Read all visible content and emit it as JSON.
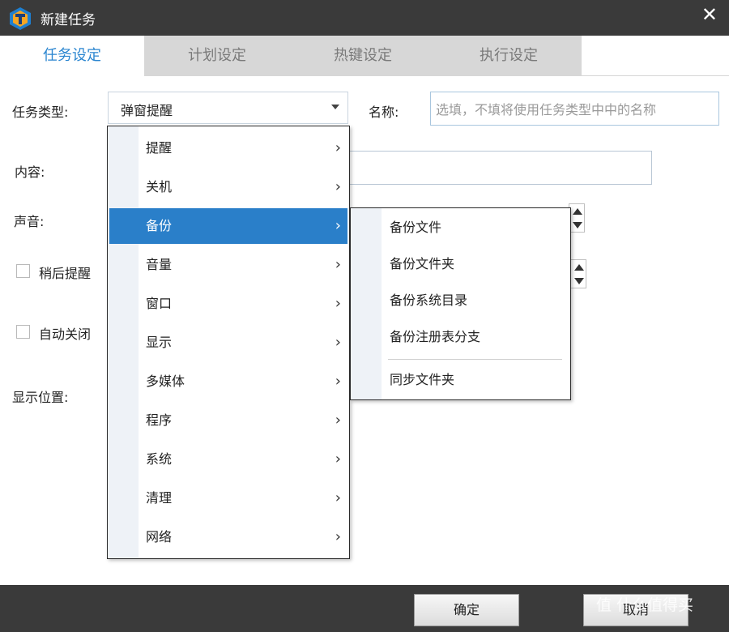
{
  "window": {
    "title": "新建任务"
  },
  "tabs": [
    {
      "label": "任务设定",
      "active": true
    },
    {
      "label": "计划设定",
      "active": false
    },
    {
      "label": "热键设定",
      "active": false
    },
    {
      "label": "执行设定",
      "active": false
    }
  ],
  "form": {
    "task_type_label": "任务类型:",
    "task_type_value": "弹窗提醒",
    "name_label": "名称:",
    "name_placeholder": "选填，不填将使用任务类型中中的名称",
    "content_label": "内容:",
    "sound_label": "声音:",
    "remind_later_label": "稍后提醒",
    "auto_close_label": "自动关闭",
    "display_position_label": "显示位置:"
  },
  "menu": {
    "items": [
      "提醒",
      "关机",
      "备份",
      "音量",
      "窗口",
      "显示",
      "多媒体",
      "程序",
      "系统",
      "清理",
      "网络"
    ],
    "highlighted_index": 2,
    "arrow": "›"
  },
  "submenu": {
    "items": [
      "备份文件",
      "备份文件夹",
      "备份系统目录",
      "备份注册表分支"
    ],
    "after_separator": "同步文件夹"
  },
  "footer": {
    "ok_label": "确定",
    "cancel_label": "取消",
    "watermark": "值 什么值得买"
  },
  "colors": {
    "titlebar": "#3a3a3a",
    "accent": "#2a7fc9",
    "tab_active_text": "#2b86d0",
    "tab_inactive_bg": "#d7d7d7"
  }
}
